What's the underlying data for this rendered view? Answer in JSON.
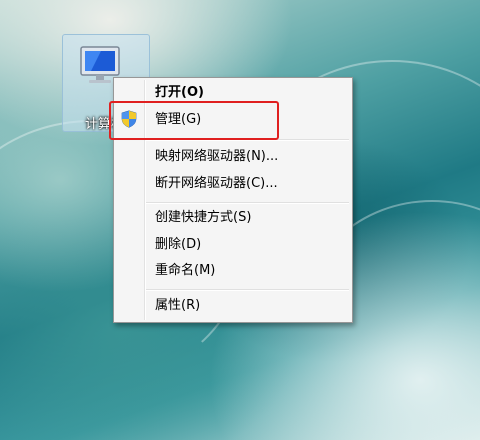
{
  "desktop": {
    "icon_label": "计算机"
  },
  "context_menu": {
    "items": [
      {
        "label": "打开(O)"
      },
      {
        "label": "管理(G)"
      },
      {
        "label": "映射网络驱动器(N)..."
      },
      {
        "label": "断开网络驱动器(C)..."
      },
      {
        "label": "创建快捷方式(S)"
      },
      {
        "label": "删除(D)"
      },
      {
        "label": "重命名(M)"
      },
      {
        "label": "属性(R)"
      }
    ]
  },
  "colors": {
    "highlight_border": "#e02020",
    "menu_background": "#f5f5f5"
  },
  "icons": {
    "manage": "uac-shield-icon",
    "computer": "computer-icon"
  }
}
